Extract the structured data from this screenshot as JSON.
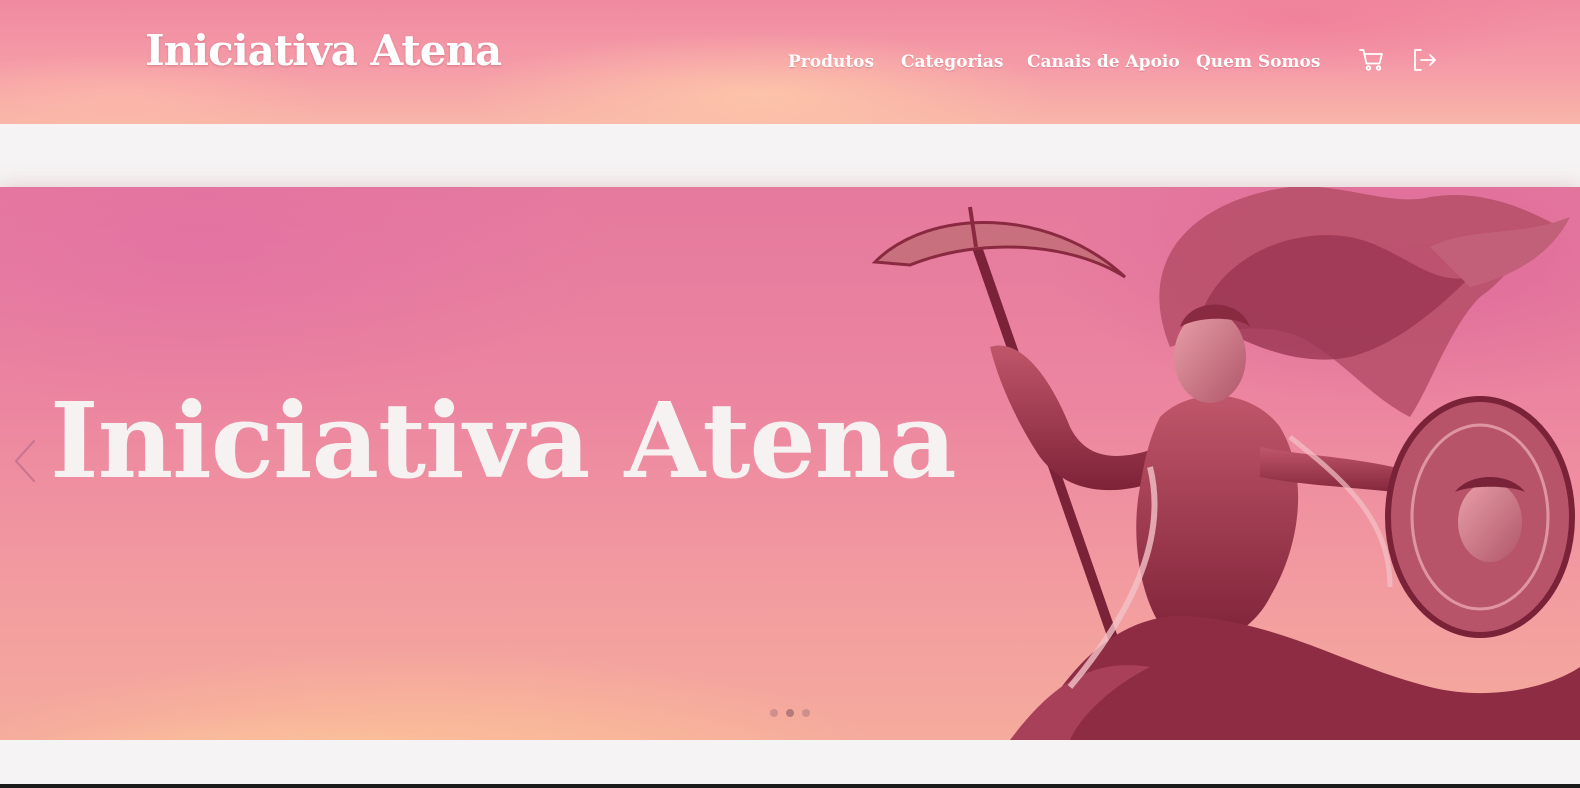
{
  "header": {
    "brand": "Iniciativa Atena",
    "nav": [
      "Produtos",
      "Categorias",
      "Canais de Apoio",
      "Quem Somos"
    ],
    "icons": {
      "cart": "cart-icon",
      "logout": "logout-icon"
    }
  },
  "hero": {
    "title": "Iniciativa Atena",
    "slides_total": 3,
    "active_slide": 2,
    "prev_icon": "chevron-left-icon"
  },
  "colors": {
    "header_pink": "#f59ca8",
    "hero_pink": "#ec86a0",
    "text_white": "#ffffff",
    "figure_dark": "#8a2a40"
  }
}
